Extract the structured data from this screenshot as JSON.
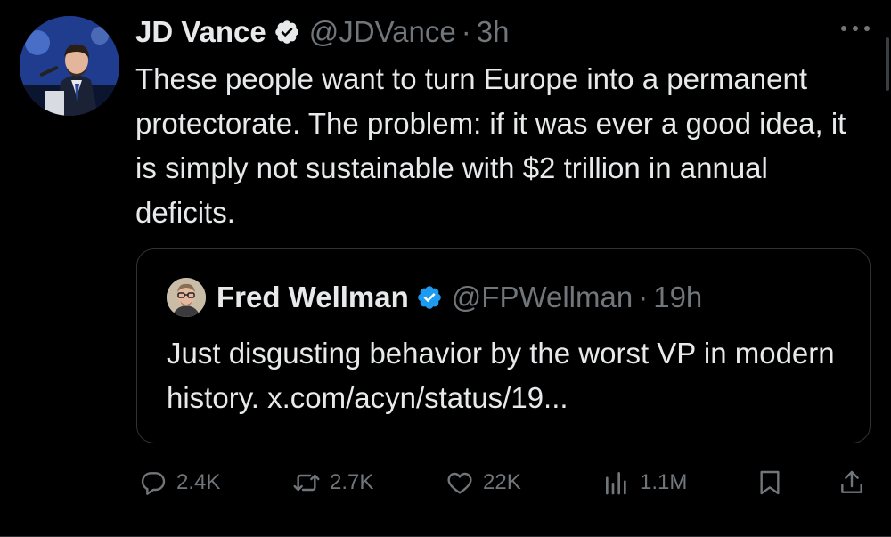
{
  "post": {
    "author_name": "JD Vance",
    "handle": "@JDVance",
    "separator": "·",
    "time": "3h",
    "text": "These people want to turn Europe into a permanent protectorate. The problem: if it was ever a good idea, it is simply not sustainable with $2 trillion in annual deficits."
  },
  "quote": {
    "author_name": "Fred Wellman",
    "handle": "@FPWellman",
    "separator": "·",
    "time": "19h",
    "text": "Just disgusting behavior by the worst VP in modern history. x.com/acyn/status/19..."
  },
  "actions": {
    "replies": "2.4K",
    "reposts": "2.7K",
    "likes": "22K",
    "views": "1.1M"
  },
  "icons": {
    "verified": "verified-badge-icon",
    "more": "more-options-icon",
    "reply": "reply-icon",
    "repost": "repost-icon",
    "like": "heart-icon",
    "views": "views-icon",
    "bookmark": "bookmark-icon",
    "share": "share-icon"
  },
  "colors": {
    "background": "#000000",
    "text": "#e7e9ea",
    "secondary": "#71767b",
    "verified_blue": "#1d9bf0",
    "border": "#2f3336"
  }
}
